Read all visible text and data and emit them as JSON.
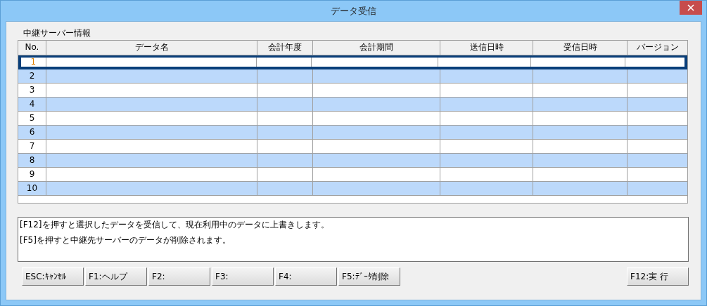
{
  "window": {
    "title": "データ受信"
  },
  "section_label": "中継サーバー情報",
  "table": {
    "columns": [
      "No.",
      "データ名",
      "会計年度",
      "会計期間",
      "送信日時",
      "受信日時",
      "バージョン"
    ],
    "rows": [
      {
        "no": "1",
        "selected": true
      },
      {
        "no": "2",
        "selected": false
      },
      {
        "no": "3",
        "selected": false
      },
      {
        "no": "4",
        "selected": false
      },
      {
        "no": "5",
        "selected": false
      },
      {
        "no": "6",
        "selected": false
      },
      {
        "no": "7",
        "selected": false
      },
      {
        "no": "8",
        "selected": false
      },
      {
        "no": "9",
        "selected": false
      },
      {
        "no": "10",
        "selected": false
      }
    ]
  },
  "messages": [
    "[F12]を押すと選択したデータを受信して、現在利用中のデータに上書きします。",
    "[F5]を押すと中継先サーバーのデータが削除されます。"
  ],
  "buttons": [
    "ESC:ｷｬﾝｾﾙ",
    "F1:ヘルプ",
    "F2:",
    "F3:",
    "F4:",
    "F5:ﾃﾞｰﾀ削除"
  ],
  "execute_button": "F12:実 行"
}
